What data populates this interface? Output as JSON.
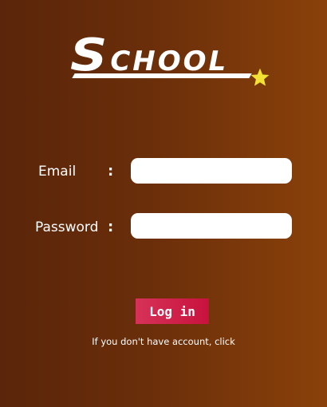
{
  "logo": {
    "first_letter": "S",
    "rest": "CHOOL"
  },
  "form": {
    "email_label": "Email",
    "email_colon": ":",
    "email_value": "",
    "password_label": "Password",
    "password_colon": ":",
    "password_value": ""
  },
  "actions": {
    "login_label": "Log in"
  },
  "footer": {
    "signup_text": "If you don't have account, click"
  },
  "colors": {
    "background_left": "#5a250a",
    "background_right": "#8a410a",
    "button": "#d0224c",
    "star": "#f2e233"
  },
  "icons": {
    "star": "star-icon"
  }
}
